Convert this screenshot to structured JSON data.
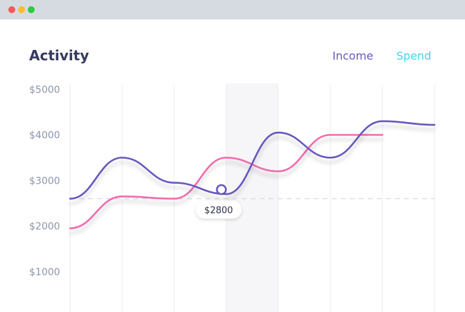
{
  "window": {
    "buttons": [
      {
        "name": "close",
        "color": "#f85955"
      },
      {
        "name": "minimize",
        "color": "#f8be2b"
      },
      {
        "name": "maximize",
        "color": "#2ecb43"
      }
    ]
  },
  "header": {
    "title": "Activity"
  },
  "chart_data": {
    "type": "line",
    "title": "Activity",
    "xlabel": "",
    "ylabel": "",
    "ylim": [
      0,
      5000
    ],
    "yticks": [
      1000,
      2000,
      3000,
      4000,
      5000
    ],
    "ytick_labels": [
      "$1000",
      "$2000",
      "$3000",
      "$4000",
      "$5000"
    ],
    "grid": true,
    "legend_position": "top-right",
    "x": [
      0,
      1,
      2,
      3,
      4,
      5,
      6,
      7
    ],
    "series": [
      {
        "name": "Income",
        "color": "#6a56bf",
        "x": [
          0,
          1,
          2,
          3,
          4,
          5,
          6,
          7
        ],
        "values": [
          2600,
          3500,
          2950,
          2700,
          4050,
          3500,
          4300,
          4220
        ]
      },
      {
        "name": "Spend",
        "legend_color": "#44d1ee",
        "color": "#f36aac",
        "x": [
          0,
          1,
          2,
          3,
          4,
          5,
          6
        ],
        "values": [
          1950,
          2650,
          2600,
          3500,
          3200,
          4000,
          4000
        ]
      }
    ],
    "highlight_band": {
      "x_from": 3,
      "x_to": 4
    },
    "reference_line": {
      "value": 2600
    },
    "marker": {
      "series": "Income",
      "x": 3,
      "value": 2800,
      "label": "$2800"
    }
  }
}
